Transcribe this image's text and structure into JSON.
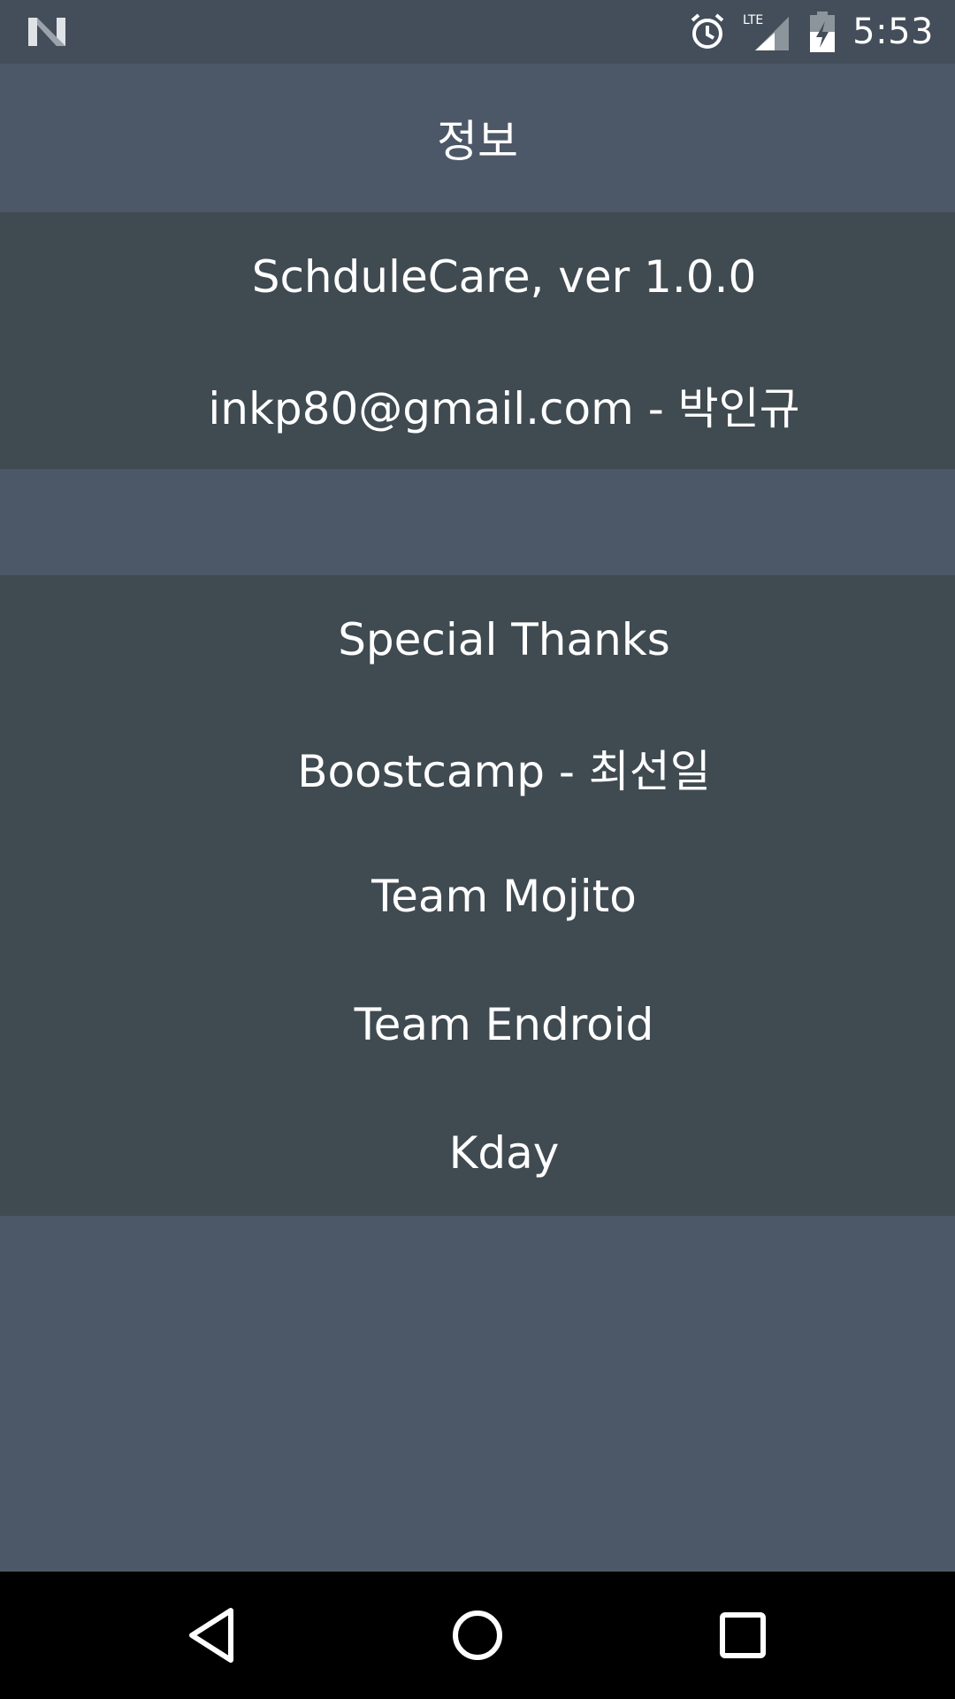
{
  "status_bar": {
    "time": "5:53",
    "network_label": "LTE",
    "icons": [
      "n-logo-icon",
      "alarm-icon",
      "lte-signal-icon",
      "battery-charging-icon"
    ]
  },
  "app_bar": {
    "title": "정보"
  },
  "info_section": {
    "items": [
      {
        "text": "SchduleCare, ver 1.0.0"
      },
      {
        "text": "inkp80@gmail.com - 박인규"
      }
    ]
  },
  "thanks_section": {
    "items": [
      {
        "text": "Special Thanks"
      },
      {
        "text": "Boostcamp - 최선일"
      },
      {
        "text": "Team Mojito"
      },
      {
        "text": "Team Endroid"
      },
      {
        "text": "Kday"
      }
    ]
  },
  "nav_bar": {
    "icons": [
      "back-icon",
      "home-icon",
      "recents-icon"
    ]
  },
  "colors": {
    "background": "#4c5867",
    "panel": "#3f4a51",
    "status_bar": "#434e5a",
    "nav_bar": "#000000",
    "text": "#ffffff"
  }
}
